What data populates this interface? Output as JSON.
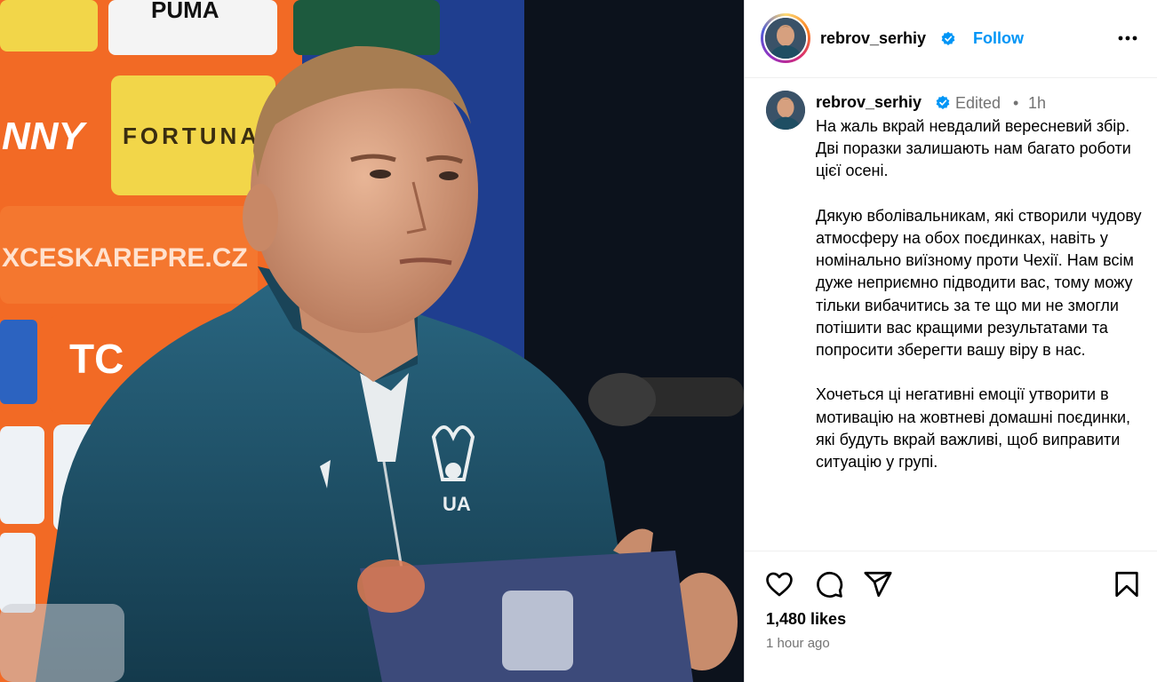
{
  "post": {
    "username": "rebrov_serhiy",
    "follow_label": "Follow",
    "edited_label": "Edited",
    "separator": "•",
    "time_short": "1h",
    "caption": "На жаль вкрай невдалий вересневий збір. Дві поразки залишають нам багато роботи цієї осені.\n\nДякую вболівальникам, які створили чудову атмосферу на обох поєдинках, навіть у номінально виїзному проти Чехії. Нам всім дуже неприємно підводити вас, тому можу тільки вибачитись за те що ми не змогли потішити вас кращими результатами та попросити зберегти вашу віру в нас.\n\nХочеться ці негативні емоції утворити в мотивацію на жовтневі домашні поєдинки, які будуть вкрай важливі, щоб виправити ситуацію у групі.",
    "likes": "1,480 likes",
    "time_ago": "1 hour ago"
  },
  "photo": {
    "backdrop_logos": [
      "PUMA",
      "NNY",
      "FORTUNA",
      "XCESKAREPRE.CZ",
      "TC"
    ],
    "kit_text": "UA"
  },
  "icons": {
    "verified": "verified-badge-icon",
    "more": "more-options-icon",
    "like": "heart-icon",
    "comment": "comment-icon",
    "share": "share-icon",
    "save": "bookmark-icon"
  },
  "colors": {
    "accent": "#0095f6",
    "verified": "#0095f6",
    "muted": "#737373",
    "backdrop_orange": "#f26a25",
    "backdrop_yellow": "#f2d649",
    "jacket": "#1f4e63"
  }
}
